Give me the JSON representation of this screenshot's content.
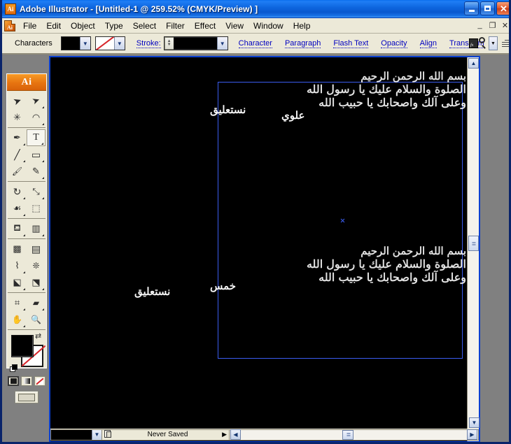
{
  "window": {
    "app_icon": "Ai",
    "title": "Adobe Illustrator - [Untitled-1 @ 259.52% (CMYK/Preview) ]",
    "minimize": "_",
    "maximize": "□",
    "close": "✕"
  },
  "menubar": {
    "items": [
      "File",
      "Edit",
      "Object",
      "Type",
      "Select",
      "Filter",
      "Effect",
      "View",
      "Window",
      "Help"
    ],
    "mdi": {
      "minimize": "_",
      "restore": "❐",
      "close": "✕"
    }
  },
  "controlbar": {
    "label": "Characters",
    "fill_swatch": "#000000",
    "stroke_swatch": "none",
    "stroke_label": "Stroke:",
    "stroke_value": "",
    "links": [
      "Character",
      "Paragraph",
      "Flash Text",
      "Opacity",
      "Align",
      "Transform"
    ],
    "right_icons": [
      "document-effects-icon",
      "panel-dropdown-icon",
      "dock-grip-icon"
    ]
  },
  "toolbox": {
    "header": "Ai",
    "tools": [
      {
        "name": "selection-tool",
        "glyph": "➤",
        "selected": false,
        "flyout": false
      },
      {
        "name": "direct-selection-tool",
        "glyph": "➤",
        "selected": false,
        "flyout": true
      },
      {
        "name": "magic-wand-tool",
        "glyph": "✳",
        "selected": false,
        "flyout": false
      },
      {
        "name": "lasso-tool",
        "glyph": "◠",
        "selected": false,
        "flyout": true
      },
      {
        "name": "pen-tool",
        "glyph": "✒",
        "selected": false,
        "flyout": true
      },
      {
        "name": "type-tool",
        "glyph": "T",
        "selected": true,
        "flyout": true
      },
      {
        "name": "line-segment-tool",
        "glyph": "╱",
        "selected": false,
        "flyout": true
      },
      {
        "name": "rectangle-tool",
        "glyph": "▭",
        "selected": false,
        "flyout": true
      },
      {
        "name": "paintbrush-tool",
        "glyph": "🖌",
        "selected": false,
        "flyout": false
      },
      {
        "name": "pencil-tool",
        "glyph": "✎",
        "selected": false,
        "flyout": true
      },
      {
        "name": "rotate-tool",
        "glyph": "↻",
        "selected": false,
        "flyout": true
      },
      {
        "name": "scale-tool",
        "glyph": "⤢",
        "selected": false,
        "flyout": true
      },
      {
        "name": "warp-tool",
        "glyph": "☙",
        "selected": false,
        "flyout": true
      },
      {
        "name": "free-transform-tool",
        "glyph": "⬚",
        "selected": false,
        "flyout": false
      },
      {
        "name": "symbol-sprayer-tool",
        "glyph": "⛾",
        "selected": false,
        "flyout": true
      },
      {
        "name": "column-graph-tool",
        "glyph": "▥",
        "selected": false,
        "flyout": true
      },
      {
        "name": "mesh-tool",
        "glyph": "▩",
        "selected": false,
        "flyout": false
      },
      {
        "name": "gradient-tool",
        "glyph": "▤",
        "selected": false,
        "flyout": false
      },
      {
        "name": "eyedropper-tool",
        "glyph": "⌇",
        "selected": false,
        "flyout": true
      },
      {
        "name": "blend-tool",
        "glyph": "❊",
        "selected": false,
        "flyout": false
      },
      {
        "name": "live-paint-bucket-tool",
        "glyph": "⬕",
        "selected": false,
        "flyout": true
      },
      {
        "name": "live-paint-selection-tool",
        "glyph": "⬔",
        "selected": false,
        "flyout": true
      },
      {
        "name": "slice-tool",
        "glyph": "⌗",
        "selected": false,
        "flyout": true
      },
      {
        "name": "eraser-tool",
        "glyph": "▰",
        "selected": false,
        "flyout": true
      },
      {
        "name": "hand-tool",
        "glyph": "✋",
        "selected": false,
        "flyout": true
      },
      {
        "name": "zoom-tool",
        "glyph": "🔍",
        "selected": false,
        "flyout": false
      }
    ],
    "fill_color": "#000000",
    "stroke_color": "none",
    "swap_icon": "⇄",
    "modes": [
      {
        "name": "color-mode-button",
        "active": true
      },
      {
        "name": "gradient-mode-button",
        "active": false
      },
      {
        "name": "none-mode-button",
        "active": false
      }
    ],
    "screen_mode": "standard-screen-mode"
  },
  "document": {
    "artboard_border_color": "#3b5df0",
    "canvas_background": "#000000",
    "artwork": {
      "block1": {
        "lines": [
          "بسم الله الرحمن الرحيم",
          "الصلوة والسلام عليك يا رسول الله",
          "وعلى آلك واصحابك يا حبيب الله"
        ],
        "signature": "نستعليق",
        "signature2": "علوي"
      },
      "block2": {
        "lines": [
          "بسم الله الرحمن الرحيم",
          "الصلوة والسلام عليك يا رسول الله",
          "وعلى آلك واصحابك يا حبيب الله"
        ],
        "signature": "نستعليق",
        "signature2": "خمس"
      }
    }
  },
  "statusbar": {
    "zoom_level": "",
    "status_text": "Never Saved",
    "play_glyph": "▶"
  },
  "scrollbars": {
    "up": "▲",
    "down": "▼",
    "left": "◀",
    "right": "▶",
    "grip": "|||"
  }
}
